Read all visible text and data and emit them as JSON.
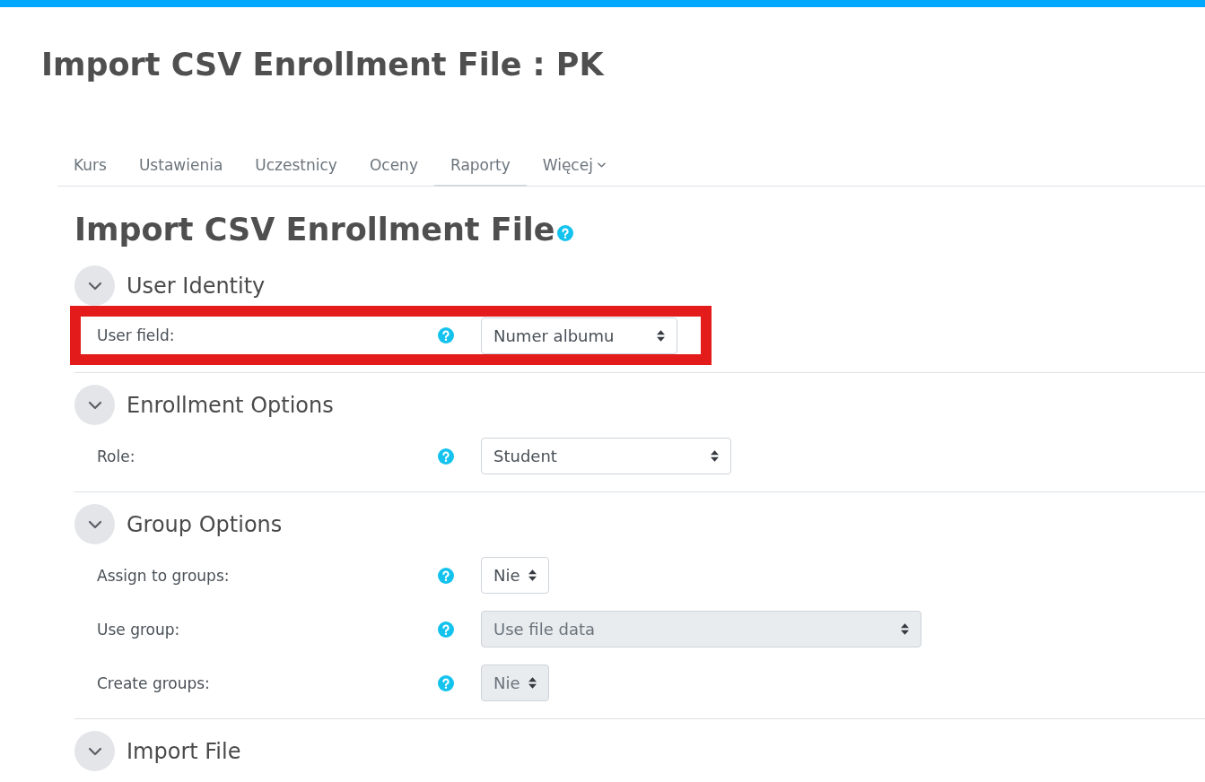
{
  "page_title": "Import CSV Enrollment File : PK",
  "tabs": [
    {
      "label": "Kurs",
      "selected": false,
      "has_menu": false
    },
    {
      "label": "Ustawienia",
      "selected": false,
      "has_menu": false
    },
    {
      "label": "Uczestnicy",
      "selected": false,
      "has_menu": false
    },
    {
      "label": "Oceny",
      "selected": false,
      "has_menu": false
    },
    {
      "label": "Raporty",
      "selected": true,
      "has_menu": false
    },
    {
      "label": "Więcej",
      "selected": false,
      "has_menu": true
    }
  ],
  "heading": "Import CSV Enrollment File",
  "sections": [
    {
      "title": "User Identity",
      "expanded": true,
      "fields": [
        {
          "label": "User field:",
          "value": "Numer albumu",
          "disabled": false,
          "highlighted": true
        }
      ]
    },
    {
      "title": "Enrollment Options",
      "expanded": true,
      "fields": [
        {
          "label": "Role:",
          "value": "Student",
          "disabled": false,
          "highlighted": false
        }
      ]
    },
    {
      "title": "Group Options",
      "expanded": true,
      "fields": [
        {
          "label": "Assign to groups:",
          "value": "Nie",
          "disabled": false,
          "highlighted": false
        },
        {
          "label": "Use group:",
          "value": "Use file data",
          "disabled": true,
          "highlighted": false
        },
        {
          "label": "Create groups:",
          "value": "Nie",
          "disabled": true,
          "highlighted": false
        }
      ]
    },
    {
      "title": "Import File",
      "expanded": true
    }
  ]
}
